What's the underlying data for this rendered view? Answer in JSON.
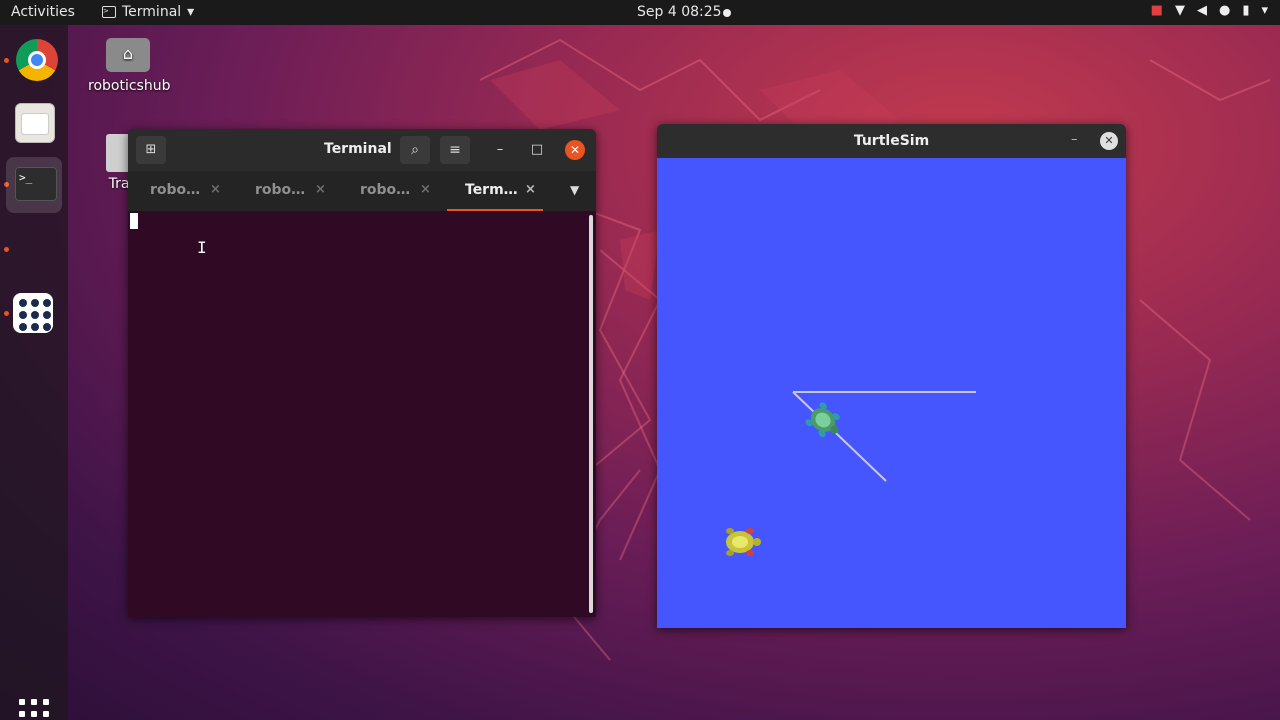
{
  "topbar": {
    "activities": "Activities",
    "app_name": "Terminal",
    "app_menu_arrow": "▾",
    "clock": "Sep 4  08:25",
    "tray_icons": [
      "camera-icon",
      "wifi-icon",
      "volume-icon",
      "mic-icon",
      "battery-icon",
      "chevron-down-icon"
    ]
  },
  "dock": {
    "items": [
      "chrome-icon",
      "files-icon",
      "terminal-icon",
      "apps-icon"
    ],
    "show_apps": "show-applications-icon"
  },
  "desktop": {
    "icons": [
      {
        "label": "roboticshub",
        "icon": "home-folder-icon"
      },
      {
        "label": "Tra",
        "icon": "trash-icon"
      }
    ]
  },
  "terminal": {
    "title": "Terminal",
    "tabs": [
      {
        "label": "robo…",
        "active": false
      },
      {
        "label": "robo…",
        "active": false
      },
      {
        "label": "robo…",
        "active": false
      },
      {
        "label": "Term…",
        "active": true
      }
    ],
    "tab_close": "×",
    "buttons": {
      "minimize": "–",
      "maximize": "□",
      "close": "✕",
      "search": "⌕",
      "menu": "≡",
      "new_tab": "⊞"
    }
  },
  "turtlesim": {
    "title": "TurtleSim",
    "minimize": "–",
    "close": "✕",
    "background": "#4556ff"
  },
  "colors": {
    "accent": "#e95420",
    "terminal_bg": "#300a24"
  }
}
